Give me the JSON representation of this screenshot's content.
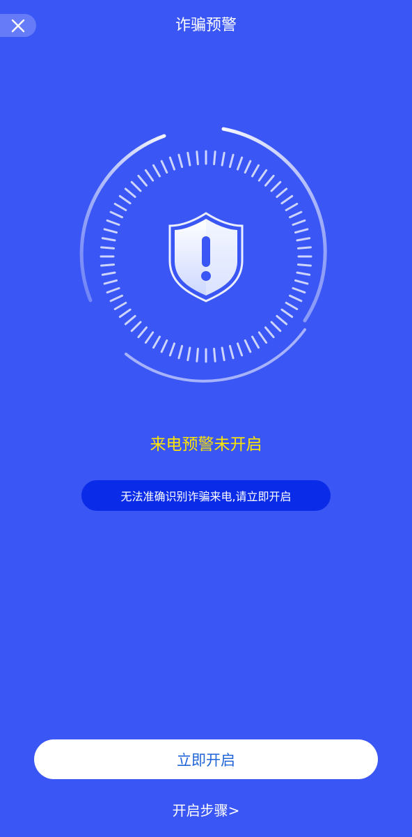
{
  "header": {
    "title": "诈骗预警",
    "close_icon": "close-icon"
  },
  "dial": {
    "center_icon": "shield-alert-icon"
  },
  "status": {
    "text": "来电预警未开启",
    "color": "#ffe500"
  },
  "hint": {
    "text": "无法准确识别诈骗来电,请立即开启"
  },
  "actions": {
    "primary_label": "立即开启",
    "steps_link": "开启步骤>"
  },
  "colors": {
    "background": "#3a56f5",
    "pill": "#0a2ce8",
    "button_text": "#1f64d8"
  }
}
